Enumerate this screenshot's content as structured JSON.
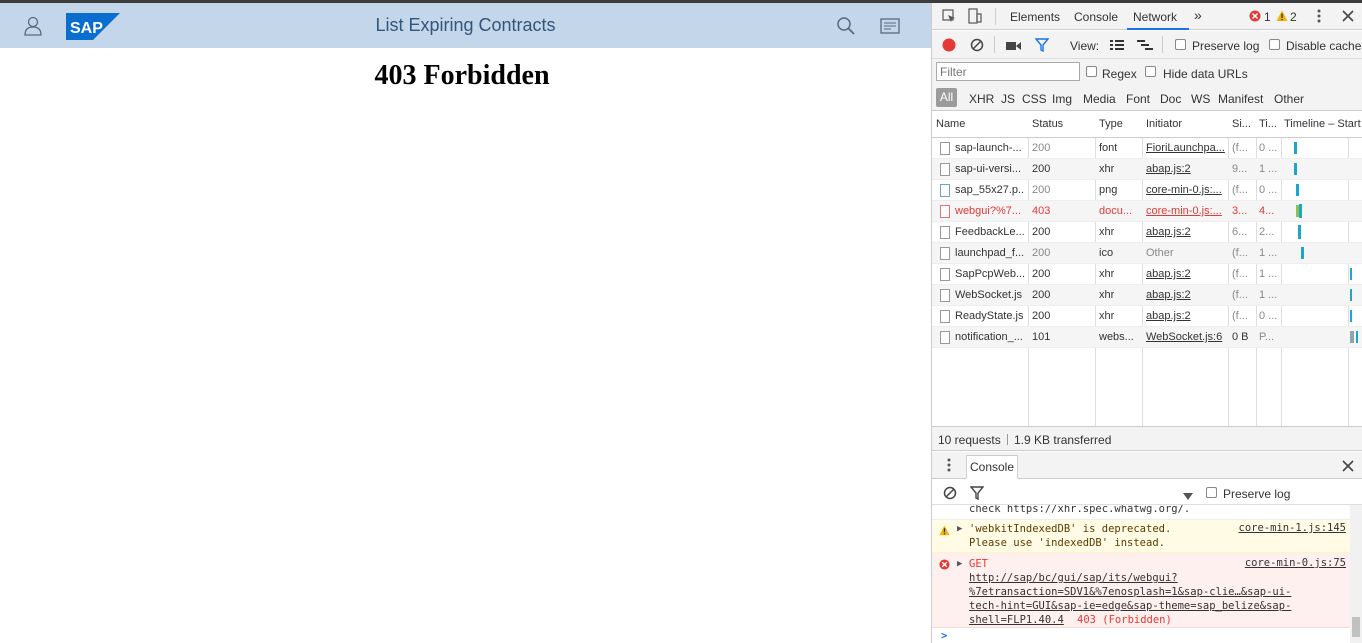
{
  "shell": {
    "title": "List Expiring Contracts",
    "logo_text": "SAP",
    "colors": {
      "bar": "#c4d7ea",
      "title": "#32557a",
      "logo": "#0a6ed1"
    }
  },
  "page": {
    "heading": "403 Forbidden"
  },
  "devtools": {
    "tabs": [
      "Elements",
      "Console",
      "Network"
    ],
    "more": "»",
    "error_count": "1",
    "warning_count": "2",
    "view_label": "View:",
    "preserve_log": "Preserve log",
    "disable_cache": "Disable cache",
    "filter_placeholder": "Filter",
    "regex": "Regex",
    "hide_data_urls": "Hide data URLs",
    "types": [
      "All",
      "XHR",
      "JS",
      "CSS",
      "Img",
      "Media",
      "Font",
      "Doc",
      "WS",
      "Manifest",
      "Other"
    ],
    "columns": [
      "Name",
      "Status",
      "Type",
      "Initiator",
      "Si...",
      "Ti...",
      "Timeline – Start T"
    ],
    "rows": [
      {
        "name": "sap-launch-...",
        "status": "200",
        "type": "font",
        "initiator": "FioriLaunchpa...",
        "size": "(f...",
        "time": "0 ..."
      },
      {
        "name": "sap-ui-versi...",
        "status": "200",
        "type": "xhr",
        "initiator": "abap.js:2",
        "size": "9...",
        "time": "1 ..."
      },
      {
        "name": "sap_55x27.p...",
        "status": "200",
        "type": "png",
        "initiator": "core-min-0.js:...",
        "size": "(f...",
        "time": "0 ..."
      },
      {
        "name": "webgui?%7...",
        "status": "403",
        "type": "docu...",
        "initiator": "core-min-0.js:...",
        "size": "3...",
        "time": "4..."
      },
      {
        "name": "FeedbackLe...",
        "status": "200",
        "type": "xhr",
        "initiator": "abap.js:2",
        "size": "6...",
        "time": "2..."
      },
      {
        "name": "launchpad_f...",
        "status": "200",
        "type": "ico",
        "initiator": "Other",
        "size": "(f...",
        "time": "1 ..."
      },
      {
        "name": "SapPcpWeb...",
        "status": "200",
        "type": "xhr",
        "initiator": "abap.js:2",
        "size": "(f...",
        "time": "1 ..."
      },
      {
        "name": "WebSocket.js",
        "status": "200",
        "type": "xhr",
        "initiator": "abap.js:2",
        "size": "(f...",
        "time": "1 ..."
      },
      {
        "name": "ReadyState.js",
        "status": "200",
        "type": "xhr",
        "initiator": "abap.js:2",
        "size": "(f...",
        "time": "0 ..."
      },
      {
        "name": "notification_...",
        "status": "101",
        "type": "webs...",
        "initiator": "WebSocket.js:6",
        "size": "0 B",
        "time": "P..."
      }
    ],
    "summary_requests": "10 requests",
    "summary_transferred": "1.9 KB transferred",
    "drawer_tab": "Console",
    "console_preserve_log": "Preserve log",
    "console": {
      "line0": "check https://xhr.spec.whatwg.org/.",
      "warn_line1": "'webkitIndexedDB' is deprecated.",
      "warn_line2": "Please use 'indexedDB' instead.",
      "warn_src": "core-min-1.js:145",
      "err_method": "GET",
      "err_src": "core-min-0.js:75",
      "err_url1": "http://sap/bc/gui/sap/its/webgui?",
      "err_url2": "%7etransaction=SDV1&%7enosplash=1&sap-clie…&sap-ui-",
      "err_url3": "tech-hint=GUI&sap-ie=edge&sap-theme=sap_belize&sap-",
      "err_url4": "shell=FLP1.40.4",
      "err_status": "403 (Forbidden)",
      "prompt": ">"
    }
  }
}
